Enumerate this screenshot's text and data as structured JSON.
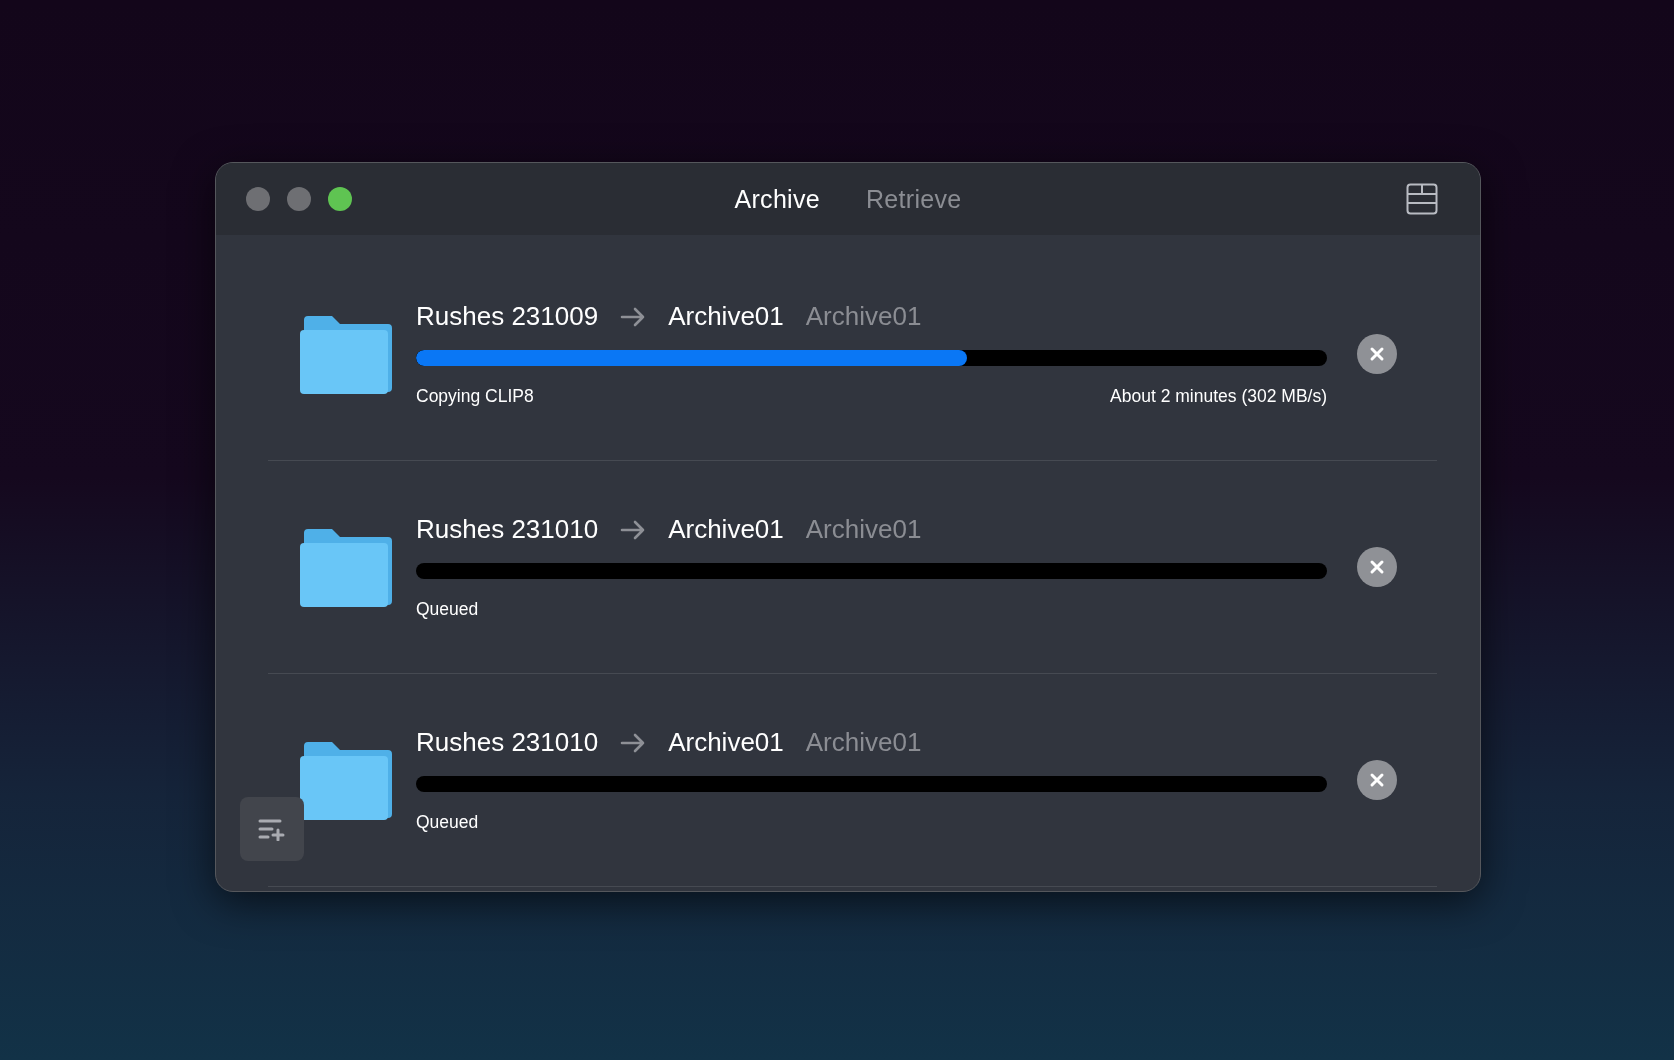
{
  "window": {
    "traffic_lights": [
      {
        "color": "#6e6f73"
      },
      {
        "color": "#6e6f73"
      },
      {
        "color": "#5fc452"
      }
    ]
  },
  "tabs": [
    {
      "label": "Archive",
      "selected": true
    },
    {
      "label": "Retrieve",
      "selected": false
    }
  ],
  "jobs": [
    {
      "source": "Rushes 231009",
      "destination": "Archive01",
      "secondary_label": "Archive01",
      "level": 0.605,
      "status": "Copying CLIP8",
      "time_remaining": "About 2 minutes (302 MB/s)"
    },
    {
      "source": "Rushes 231010",
      "destination": "Archive01",
      "secondary_label": "Archive01",
      "status": "Queued"
    },
    {
      "source": "Rushes 231010",
      "destination": "Archive01",
      "secondary_label": "Archive01",
      "status": "Queued"
    }
  ]
}
